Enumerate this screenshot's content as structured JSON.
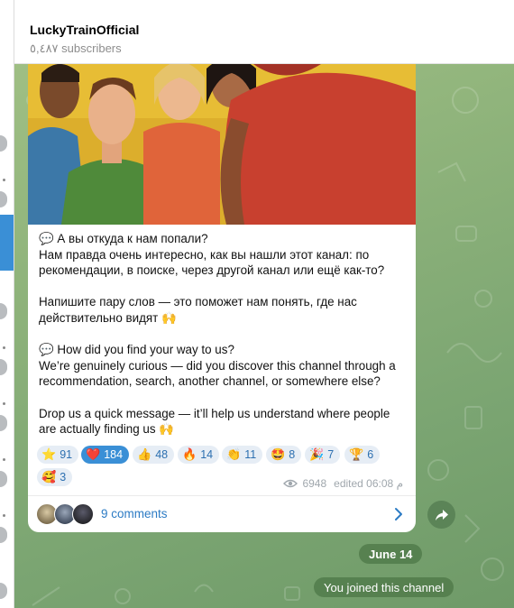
{
  "channel": {
    "name": "LuckyTrainOfficial",
    "subscribers": "٥,٤٨٧ subscribers"
  },
  "post": {
    "paragraphs": [
      "💬 А вы откуда к нам попали?\nНам правда очень интересно, как вы нашли этот канал: по рекомендации, в поиске, через другой канал или ещё как-то?",
      "Напишите пару слов — это поможет нам понять, где нас действительно видят 🙌",
      "💬 How did you find your way to us?\nWe’re genuinely curious — did you discover this channel through a recommendation, search, another channel, or somewhere else?",
      "Drop us a quick message — it’ll help us understand where people are actually finding us 🙌"
    ],
    "reactions": [
      {
        "emoji": "⭐",
        "count": "91",
        "selected": false
      },
      {
        "emoji": "❤️",
        "count": "184",
        "selected": true
      },
      {
        "emoji": "👍",
        "count": "48",
        "selected": false
      },
      {
        "emoji": "🔥",
        "count": "14",
        "selected": false
      },
      {
        "emoji": "👏",
        "count": "11",
        "selected": false
      },
      {
        "emoji": "🤩",
        "count": "8",
        "selected": false
      },
      {
        "emoji": "🎉",
        "count": "7",
        "selected": false
      },
      {
        "emoji": "🏆",
        "count": "6",
        "selected": false
      },
      {
        "emoji": "🥰",
        "count": "3",
        "selected": false
      }
    ],
    "views": "6948",
    "edited_time": "edited 06:08 م",
    "comments_label": "9 comments"
  },
  "service": {
    "date": "June 14",
    "joined": "You joined this channel"
  },
  "icons": {
    "views": "eye-icon",
    "comments_arrow": "chevron-right-icon",
    "share": "share-arrow-icon"
  },
  "colors": {
    "accent": "#3a8fd6",
    "link": "#2c7bc4",
    "chat_bg": "#8db27a"
  }
}
